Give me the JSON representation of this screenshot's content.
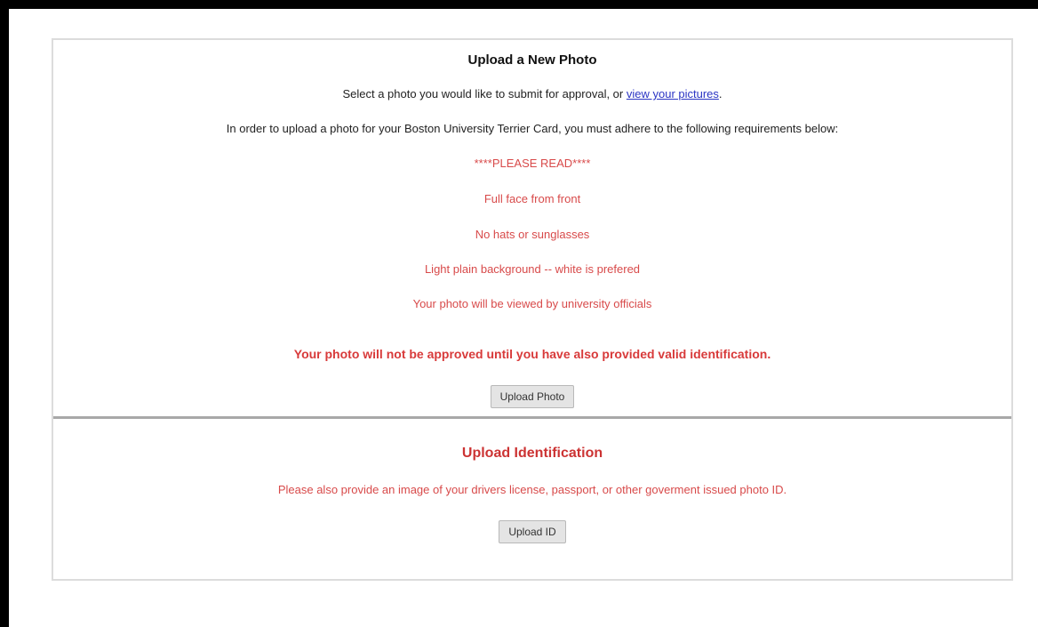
{
  "photo_section": {
    "title": "Upload a New Photo",
    "intro_prefix": "Select a photo you would like to submit for approval, or ",
    "intro_link": "view your pictures",
    "intro_suffix": ".",
    "requirement_notice": "In order to upload a photo for your Boston University Terrier Card, you must adhere to the following requirements below:",
    "please_read": "****PLEASE READ****",
    "requirements": [
      "Full face from front",
      "No hats or sunglasses",
      "Light plain background -- white is prefered",
      "Your photo will be viewed by university officials"
    ],
    "warning": "Your photo will not be approved until you have also provided valid identification.",
    "upload_button": "Upload Photo"
  },
  "id_section": {
    "title": "Upload Identification",
    "description": "Please also provide an image of your drivers license, passport, or other goverment issued photo ID.",
    "upload_button": "Upload ID"
  },
  "colors": {
    "link": "#2b35c4",
    "warning_red": "#d83a3a",
    "divider": "#a8a8a8"
  }
}
